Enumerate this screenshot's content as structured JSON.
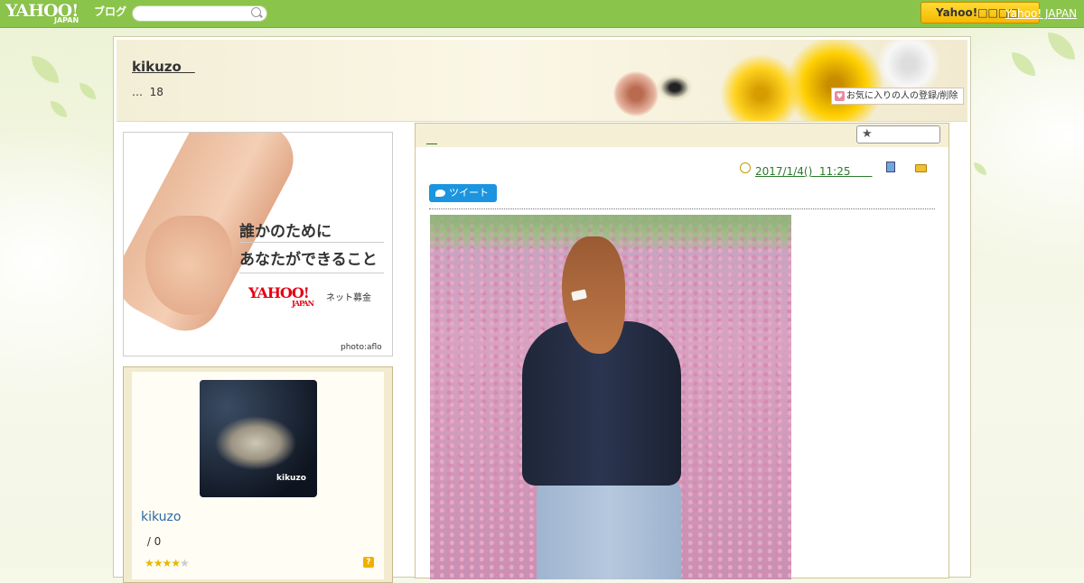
{
  "topbar": {
    "logo": "YAHOO!",
    "logo_sub": "JAPAN",
    "logo_blog": "ブログ",
    "search_placeholder": "",
    "yj_button_label": "Yahoo!□□□□",
    "yj_link": "Yahoo! JAPAN"
  },
  "header": {
    "blog_title": "kikuzo　",
    "description": "…  18",
    "favorite_label": "お気に入りの人の登録/削除"
  },
  "banner": {
    "line1": "誰かのために",
    "line2": "あなたができること",
    "logo": "YAHOO!",
    "logo_sub": "JAPAN",
    "sub": "ネット募金",
    "credit": "photo:aflo"
  },
  "profile": {
    "avatar_caption": "kikuzo",
    "name": "kikuzo",
    "stat": " / 0",
    "stars_on": "★★★★",
    "stars_off": "★",
    "help": "?"
  },
  "article": {
    "title": "　",
    "date": "2017/1/4()  11:25　　",
    "tweet_label": "ツイート"
  },
  "colors": {
    "topbar": "#8bc44a",
    "link_green": "#2a7a2a",
    "tweet_blue": "#1b95e0",
    "yj_yellow": "#f5b800"
  }
}
